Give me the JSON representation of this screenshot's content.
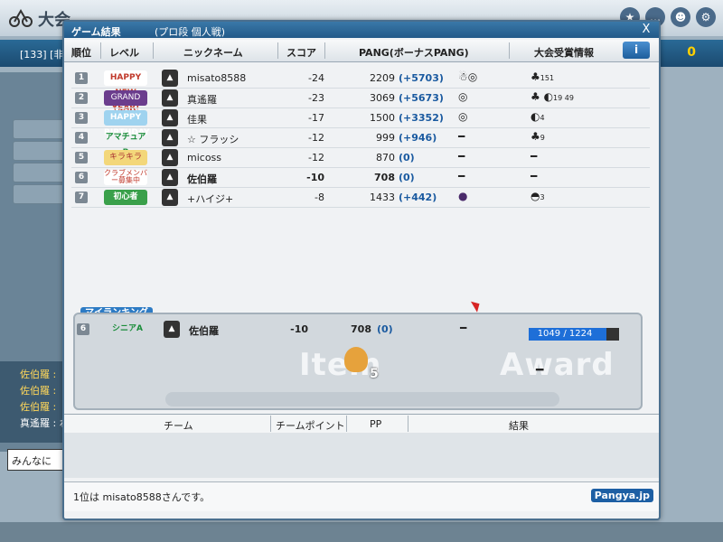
{
  "background": {
    "title": "大会",
    "room_text": "[133] [非",
    "score": "0",
    "chat_lines": [
      "佐伯羅 :",
      "佐伯羅 :",
      "佐伯羅 :",
      "真遙羅 : ね"
    ],
    "chat_input": "みんなに"
  },
  "dialog": {
    "title": "ゲーム結果",
    "subtitle": "(プロ段 個人戦)",
    "close": "X",
    "columns": [
      "順位",
      "レベル",
      "ニックネーム",
      "スコア",
      "PANG(ボーナスPANG)",
      "大会受賞情報"
    ],
    "info_button": "i"
  },
  "rows": [
    {
      "rank": "1",
      "level": "HAPPY NEW YEAR!",
      "nick": "misato8588",
      "score": "-24",
      "pang": "2209",
      "bonus": "(+5703)",
      "item": "☃◎",
      "award": "♣",
      "award_count": "151"
    },
    {
      "rank": "2",
      "level": "GRAND ZODIAC",
      "nick": "真遙羅",
      "score": "-23",
      "pang": "3069",
      "bonus": "(+5673)",
      "item": "◎",
      "award": "♣ ◐",
      "award_count": "19 49"
    },
    {
      "rank": "3",
      "level": "HAPPY BIRTHDAY",
      "nick": "佳果",
      "score": "-17",
      "pang": "1500",
      "bonus": "(+3352)",
      "item": "◎",
      "award": "◐",
      "award_count": "4"
    },
    {
      "rank": "4",
      "level": "アマチュアB",
      "nick": "☆ フラッシ",
      "score": "-12",
      "pang": "999",
      "bonus": "(+946)",
      "item": "━",
      "award": "♣",
      "award_count": "9"
    },
    {
      "rank": "5",
      "level": "キラキラ",
      "nick": "micoss",
      "score": "-12",
      "pang": "870",
      "bonus": "(0)",
      "item": "━",
      "award": "━",
      "award_count": ""
    },
    {
      "rank": "6",
      "level": "クラブメンバー募集中",
      "nick": "佐伯羅",
      "score": "-10",
      "pang": "708",
      "bonus": "(0)",
      "item": "━",
      "award": "━",
      "award_count": ""
    },
    {
      "rank": "7",
      "level": "初心者",
      "nick": "+ハイジ+",
      "score": "-8",
      "pang": "1433",
      "bonus": "(+442)",
      "item": "●",
      "award": "◓",
      "award_count": "3"
    }
  ],
  "myranking": {
    "tag": "マイランキング",
    "rank": "6",
    "level": "シニアA",
    "nick": "佐伯羅",
    "score": "-10",
    "pang": "708",
    "bonus": "(0)",
    "item": "━",
    "exp_text": "1049 / 1224",
    "exp_fraction": 0.857,
    "item_bg": "Item",
    "award_bg": "Award",
    "bag_count": "5"
  },
  "team": {
    "columns": [
      "チーム",
      "チームポイント",
      "PP",
      "結果"
    ]
  },
  "footer": {
    "message": "1位は misato8588さんです。",
    "brand": "Pangya.jp"
  }
}
